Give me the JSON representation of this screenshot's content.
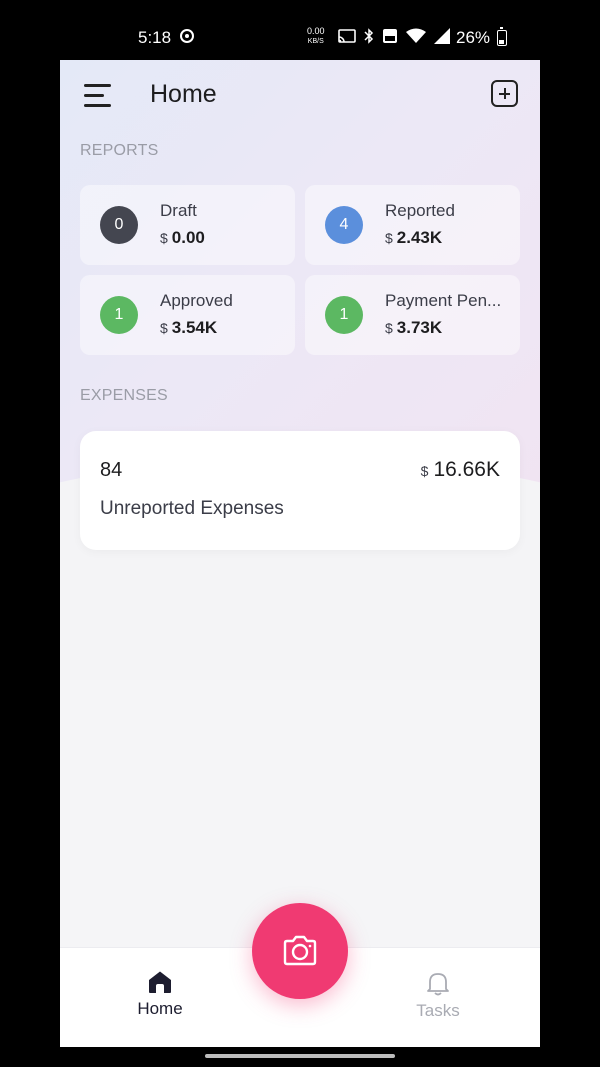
{
  "status_bar": {
    "time": "5:18",
    "net_speed": "0.00",
    "net_unit": "KB/S",
    "battery": "26%"
  },
  "header": {
    "title": "Home"
  },
  "reports": {
    "section_label": "REPORTS",
    "currency": "$",
    "cards": [
      {
        "label": "Draft",
        "count": "0",
        "amount": "0.00",
        "badge_color": "#444650"
      },
      {
        "label": "Reported",
        "count": "4",
        "amount": "2.43K",
        "badge_color": "#5b8fdc"
      },
      {
        "label": "Approved",
        "count": "1",
        "amount": "3.54K",
        "badge_color": "#5cb862"
      },
      {
        "label": "Payment Pen...",
        "count": "1",
        "amount": "3.73K",
        "badge_color": "#5cb862"
      }
    ]
  },
  "expenses": {
    "section_label": "EXPENSES",
    "count": "84",
    "currency": "$",
    "total": "16.66K",
    "label": "Unreported Expenses"
  },
  "bottom_nav": {
    "items": [
      {
        "label": "Home",
        "icon": "home-icon",
        "active": true
      },
      {
        "label": "Tasks",
        "icon": "bell-icon",
        "active": false
      }
    ],
    "camera_icon": "camera-icon"
  },
  "colors": {
    "accent": "#f03a72",
    "active_nav": "#1d1d2f",
    "inactive_nav": "#a9abb3"
  }
}
